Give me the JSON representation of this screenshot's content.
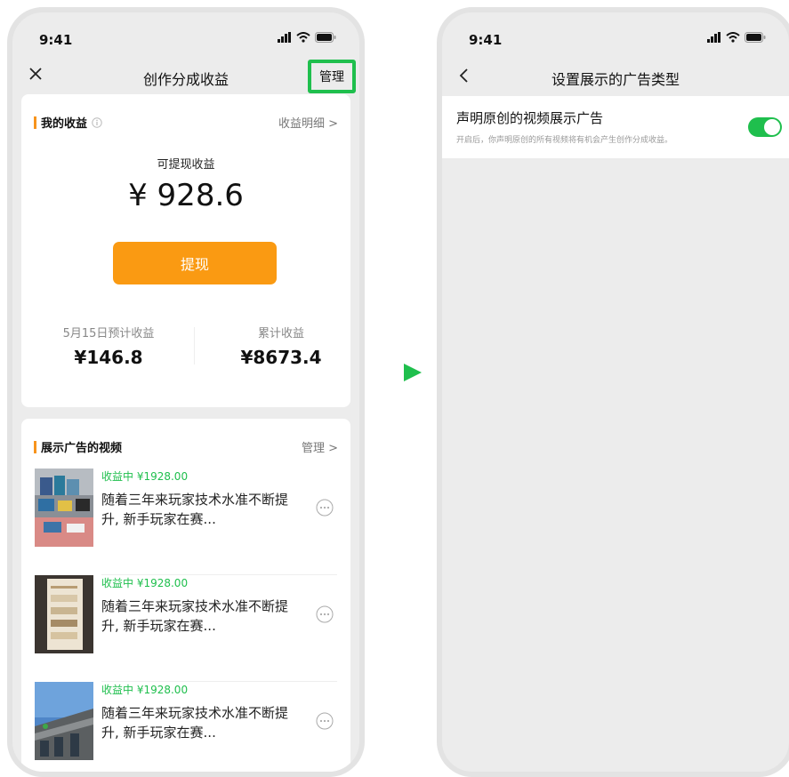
{
  "status_bar": {
    "time": "9:41"
  },
  "left_screen": {
    "title": "创作分成收益",
    "manage_label": "管理",
    "earnings": {
      "section_title": "我的收益",
      "detail_link": "收益明细 >",
      "withdrawable_label": "可提现收益",
      "withdrawable_amount": "¥ 928.6",
      "withdraw_button": "提现",
      "estimate_label": "5月15日预计收益",
      "estimate_value": "¥146.8",
      "total_label": "累计收益",
      "total_value": "¥8673.4"
    },
    "videos": {
      "section_title": "展示广告的视频",
      "manage_link": "管理 >",
      "items": [
        {
          "status": "收益中 ¥1928.00",
          "title": "随着三年来玩家技术水准不断提升, 新手玩家在赛..."
        },
        {
          "status": "收益中 ¥1928.00",
          "title": "随着三年来玩家技术水准不断提升, 新手玩家在赛..."
        },
        {
          "status": "收益中 ¥1928.00",
          "title": "随着三年来玩家技术水准不断提升, 新手玩家在赛..."
        }
      ]
    }
  },
  "right_screen": {
    "title": "设置展示的广告类型",
    "setting_title": "声明原创的视频展示广告",
    "setting_desc": "开启后，你声明原创的所有视频将有机会产生创作分成收益。",
    "toggle_on": true
  },
  "colors": {
    "accent_green": "#1fbf4d",
    "accent_orange": "#fa9a12"
  },
  "icons": [
    "close-icon",
    "info-icon",
    "more-icon",
    "back-icon",
    "arrow-right-icon",
    "signal-icon",
    "wifi-icon",
    "battery-icon"
  ]
}
